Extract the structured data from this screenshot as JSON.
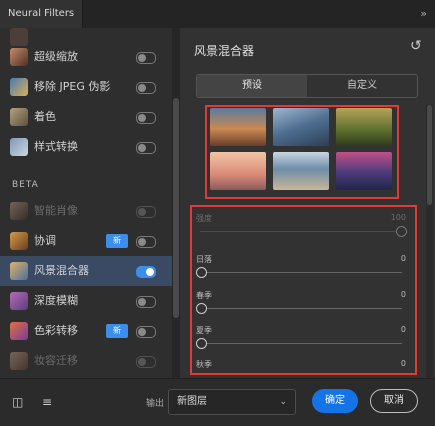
{
  "window": {
    "tab_title": "Neural Filters",
    "expand_glyph": "»"
  },
  "sidebar": {
    "items": [
      {
        "label": "超级缩放",
        "icon": "super-zoom-icon",
        "enabled": false
      },
      {
        "label": "移除 JPEG 伪影",
        "icon": "jpeg-artifacts-icon",
        "enabled": false
      },
      {
        "label": "着色",
        "icon": "colorize-icon",
        "enabled": false
      },
      {
        "label": "样式转换",
        "icon": "style-transfer-icon",
        "enabled": false
      }
    ],
    "section_label": "BETA",
    "beta_items": [
      {
        "label": "智能肖像",
        "icon": "smart-portrait-icon",
        "enabled": false,
        "dim": true
      },
      {
        "label": "协调",
        "icon": "harmonization-icon",
        "enabled": false,
        "badge": "新"
      },
      {
        "label": "风景混合器",
        "icon": "landscape-mixer-icon",
        "enabled": true,
        "selected": true
      },
      {
        "label": "深度模糊",
        "icon": "depth-blur-icon",
        "enabled": false
      },
      {
        "label": "色彩转移",
        "icon": "color-transfer-icon",
        "enabled": false,
        "badge": "新"
      },
      {
        "label": "妆容迁移",
        "icon": "makeup-transfer-icon",
        "enabled": false,
        "dim": true
      }
    ]
  },
  "panel": {
    "title": "风景混合器",
    "reset_icon": "undo-icon",
    "tabs": [
      "预设",
      "自定义"
    ],
    "active_tab": "预设",
    "presets": [
      {
        "name": "preset-autumn-lake",
        "colors": [
          "#8a5a3a",
          "#c98a52",
          "#2f3e52"
        ]
      },
      {
        "name": "preset-snow-mountain",
        "colors": [
          "#4d6d8f",
          "#9fb7cf",
          "#2d3f55"
        ]
      },
      {
        "name": "preset-green-valley",
        "colors": [
          "#5b6e2c",
          "#b6a35a",
          "#2e3b1d"
        ]
      },
      {
        "name": "preset-sunset-mist",
        "colors": [
          "#d98a78",
          "#f2c4a4",
          "#8a5a5a"
        ]
      },
      {
        "name": "preset-coast",
        "colors": [
          "#6f8da8",
          "#c9b79a",
          "#3b4a5a"
        ]
      },
      {
        "name": "preset-purple-lake",
        "colors": [
          "#4b3b7a",
          "#c0508a",
          "#20264a"
        ]
      }
    ],
    "sliders": [
      {
        "label": "强度",
        "value": "100",
        "fraction": 1.0,
        "dim": true
      },
      {
        "label": "日落",
        "value": "0",
        "fraction": 0.0
      },
      {
        "label": "春季",
        "value": "0",
        "fraction": 0.0
      },
      {
        "label": "夏季",
        "value": "0",
        "fraction": 0.0
      },
      {
        "label": "秋季",
        "value": "0",
        "fraction": 0.0
      }
    ]
  },
  "footer": {
    "output_label": "输出",
    "output_value": "新图层",
    "ok_label": "确定",
    "cancel_label": "取消"
  },
  "colors": {
    "accent": "#1473e6",
    "highlight": "#e53935",
    "selected_row": "#3a4a63"
  }
}
